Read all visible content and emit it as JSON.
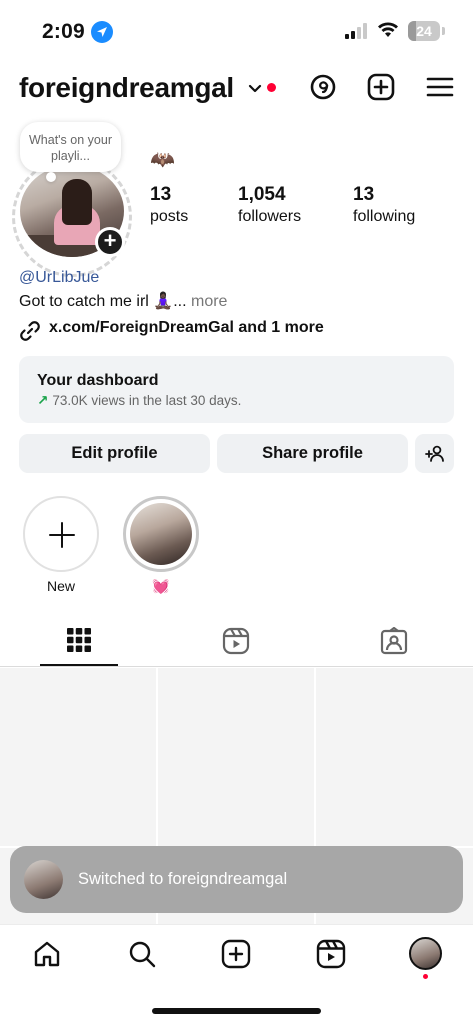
{
  "status_bar": {
    "time": "2:09",
    "battery": "24",
    "battery_level": 0.24
  },
  "header": {
    "username": "foreigndreamgal",
    "icons": [
      "chevron-down-icon",
      "threads-icon",
      "create-plus-icon",
      "menu-icon"
    ],
    "notification_color": "#ff0034"
  },
  "profile": {
    "note": "What's on your playli...",
    "bat_emoji": "🦇",
    "stats": [
      {
        "value": "13",
        "label": "posts"
      },
      {
        "value": "1,054",
        "label": "followers"
      },
      {
        "value": "13",
        "label": "following"
      }
    ],
    "handle": "@UrLibJue",
    "bio_text": "Got to catch me irl 🧘🏿‍♀️...",
    "bio_more": "more",
    "link": "x.com/ForeignDreamGal and 1 more"
  },
  "dashboard": {
    "title": "Your dashboard",
    "arrow": "↗",
    "subtitle": "73.0K views in the last 30 days."
  },
  "buttons": {
    "edit": "Edit profile",
    "share": "Share profile"
  },
  "highlights": [
    {
      "label": "New"
    },
    {
      "label": "💓"
    }
  ],
  "tabs": [
    "grid-icon",
    "reels-icon",
    "tagged-icon"
  ],
  "toast": {
    "text": "Switched to foreigndreamgal"
  },
  "nav": [
    "home-icon",
    "search-icon",
    "create-icon",
    "reels-icon",
    "profile-avatar"
  ],
  "colors": {
    "link": "#385898",
    "trend": "#1aa34a",
    "accent_red": "#ff0034"
  }
}
